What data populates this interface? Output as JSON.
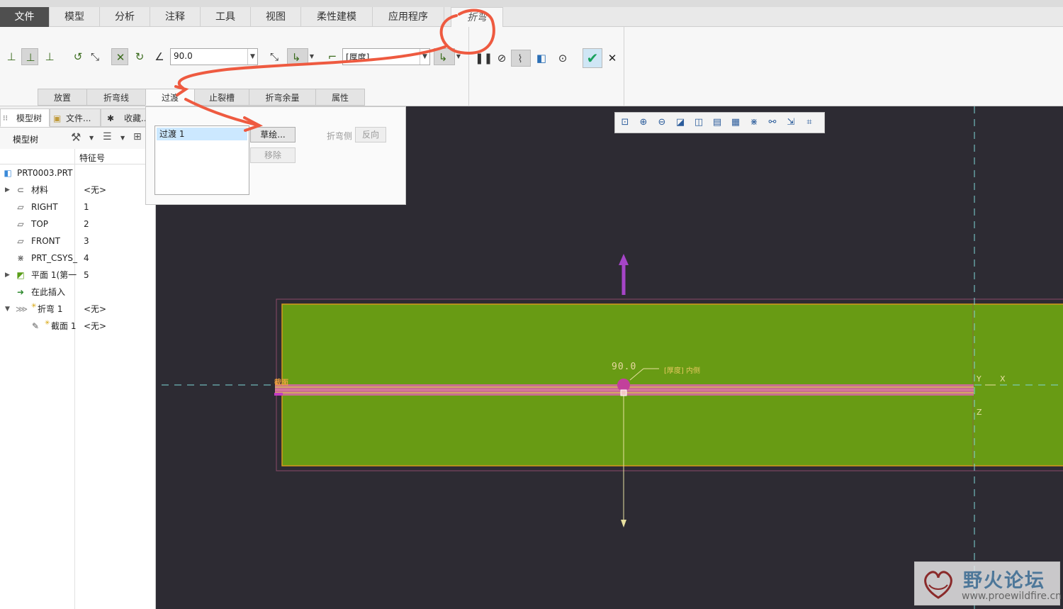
{
  "ribbon": {
    "tabs": [
      "文件",
      "模型",
      "分析",
      "注释",
      "工具",
      "视图",
      "柔性建模",
      "应用程序",
      "折弯"
    ],
    "active_tab": "折弯"
  },
  "toolbar": {
    "angle_value": "90.0",
    "thickness_option": "[厚度]"
  },
  "subtabs": [
    "放置",
    "折弯线",
    "过渡",
    "止裂槽",
    "折弯余量",
    "属性"
  ],
  "panel": {
    "list_items": [
      "过渡 1"
    ],
    "sketch_button": "草绘...",
    "remove_button": "移除",
    "bend_side_label": "折弯侧",
    "flip_button": "反向"
  },
  "navigator": {
    "tabs": [
      "模型树",
      "文件...",
      "收藏..."
    ],
    "tree_label": "模型树",
    "column_header": "特征号",
    "rows": [
      {
        "name": "PRT0003.PRT",
        "num": ""
      },
      {
        "name": "材料",
        "num": "<无>"
      },
      {
        "name": "RIGHT",
        "num": "1"
      },
      {
        "name": "TOP",
        "num": "2"
      },
      {
        "name": "FRONT",
        "num": "3"
      },
      {
        "name": "PRT_CSYS_",
        "num": "4"
      },
      {
        "name": "平面 1(第一",
        "num": "5"
      },
      {
        "name": "在此插入",
        "num": ""
      },
      {
        "name": "折弯 1",
        "num": "<无>"
      },
      {
        "name": "截面 1",
        "num": "<无>"
      }
    ]
  },
  "canvas": {
    "angle_label": "90.0",
    "dim_note": "[厚度] 内侧",
    "section_label": "截面",
    "axis_y": "Y",
    "axis_x": "X",
    "axis_z": "Z"
  },
  "watermark": {
    "title": "野火论坛",
    "url": "www.proewildfire.cn"
  },
  "colors": {
    "canvas_bg": "#2d2b33",
    "part_green": "#689b14",
    "bend_magenta": "#c2409b",
    "annotation_red": "#ee5a40"
  }
}
